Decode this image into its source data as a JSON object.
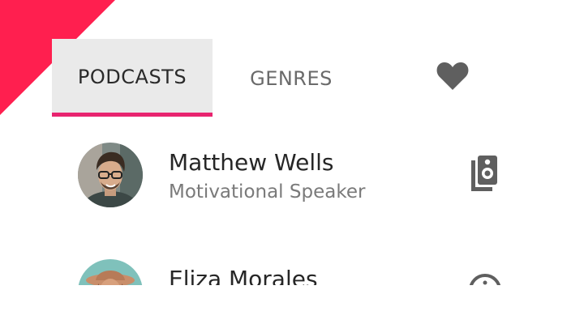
{
  "tabs": [
    {
      "label": "PODCASTS",
      "selected": true
    },
    {
      "label": "GENRES",
      "selected": false
    },
    {
      "icon": "heart-icon",
      "selected": false
    }
  ],
  "colors": {
    "accent": "#ff1f4f",
    "tab_indicator": "#e8246f",
    "selected_tab_bg": "#eaeaea",
    "icon_gray": "#5f5f5f"
  },
  "podcasts": [
    {
      "name": "Matthew Wells",
      "subtitle": "Motivational Speaker",
      "action_icon": "speaker-icon"
    },
    {
      "name": "Eliza Morales",
      "subtitle": "",
      "action_icon": "info-icon"
    }
  ]
}
